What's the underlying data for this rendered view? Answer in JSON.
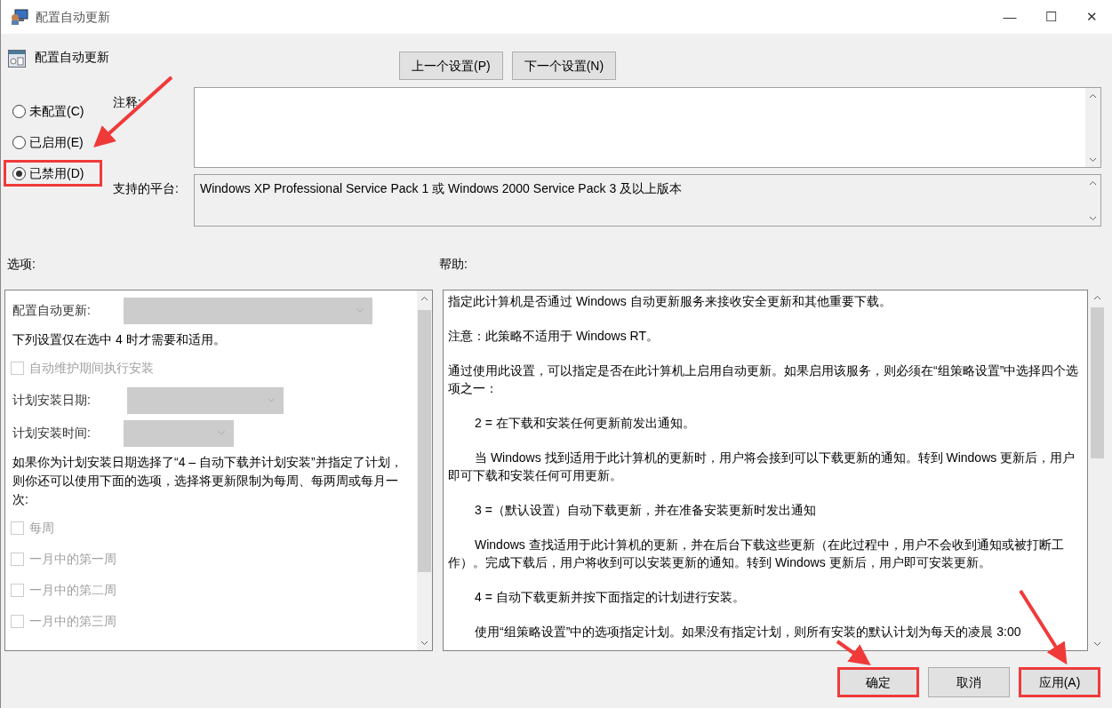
{
  "window": {
    "title": "配置自动更新",
    "controls": [
      "—",
      "☐",
      "✕"
    ]
  },
  "header": {
    "title": "配置自动更新"
  },
  "nav_buttons": [
    "上一个设置(P)",
    "下一个设置(N)"
  ],
  "radios": [
    {
      "label": "未配置(C)",
      "selected": false,
      "highlighted": false
    },
    {
      "label": "已启用(E)",
      "selected": false,
      "highlighted": false
    },
    {
      "label": "已禁用(D)",
      "selected": true,
      "highlighted": true
    }
  ],
  "comment": {
    "label": "注释:"
  },
  "platform": {
    "label": "支持的平台:",
    "value": "Windows XP Professional Service Pack 1 或 Windows 2000 Service Pack 3 及以上版本"
  },
  "options": {
    "label": "选项:",
    "items": [
      {
        "kind": "dropdown",
        "label": "配置自动更新:",
        "disabled": true
      },
      {
        "kind": "text",
        "text": "下列设置仅在选中 4 时才需要和适用。"
      },
      {
        "kind": "checkbox",
        "label": "自动维护期间执行安装",
        "checked": false,
        "disabled": true
      },
      {
        "kind": "dropdown",
        "label": "计划安装日期:",
        "disabled": true
      },
      {
        "kind": "dropdown",
        "label": "计划安装时间:",
        "disabled": true
      },
      {
        "kind": "text",
        "text": "如果你为计划安装日期选择了“4 – 自动下载并计划安装”并指定了计划，则你还可以使用下面的选项，选择将更新限制为每周、每两周或每月一次:"
      },
      {
        "kind": "checkbox",
        "label": "每周",
        "checked": false,
        "disabled": true
      },
      {
        "kind": "checkbox",
        "label": "一月中的第一周",
        "checked": false,
        "disabled": true
      },
      {
        "kind": "checkbox",
        "label": "一月中的第二周",
        "checked": false,
        "disabled": true
      },
      {
        "kind": "checkbox",
        "label": "一月中的第三周",
        "checked": false,
        "disabled": true
      }
    ]
  },
  "help": {
    "label": "帮助:",
    "paragraphs": [
      {
        "text": "指定此计算机是否通过 Windows 自动更新服务来接收安全更新和其他重要下载。",
        "indented": false
      },
      {
        "text": "注意：此策略不适用于 Windows RT。",
        "indented": false
      },
      {
        "text": "通过使用此设置，可以指定是否在此计算机上启用自动更新。如果启用该服务，则必须在“组策略设置”中选择四个选项之一：",
        "indented": false
      },
      {
        "text": "2 = 在下载和安装任何更新前发出通知。",
        "indented": true
      },
      {
        "text": "当 Windows 找到适用于此计算机的更新时，用户将会接到可以下载更新的通知。转到 Windows 更新后，用户即可下载和安装任何可用更新。",
        "indented": true
      },
      {
        "text": "3 =（默认设置）自动下载更新，并在准备安装更新时发出通知",
        "indented": true
      },
      {
        "text": "Windows 查找适用于此计算机的更新，并在后台下载这些更新（在此过程中，用户不会收到通知或被打断工作）。完成下载后，用户将收到可以安装更新的通知。转到 Windows 更新后，用户即可安装更新。",
        "indented": true
      },
      {
        "text": "4 = 自动下载更新并按下面指定的计划进行安装。",
        "indented": true
      },
      {
        "text": "使用“组策略设置”中的选项指定计划。如果没有指定计划，则所有安装的默认计划为每天的凌晨 3:00",
        "indented": true
      }
    ]
  },
  "buttons": [
    {
      "label": "确定",
      "highlighted": true
    },
    {
      "label": "取消",
      "highlighted": false
    },
    {
      "label": "应用(A)",
      "highlighted": true
    }
  ]
}
